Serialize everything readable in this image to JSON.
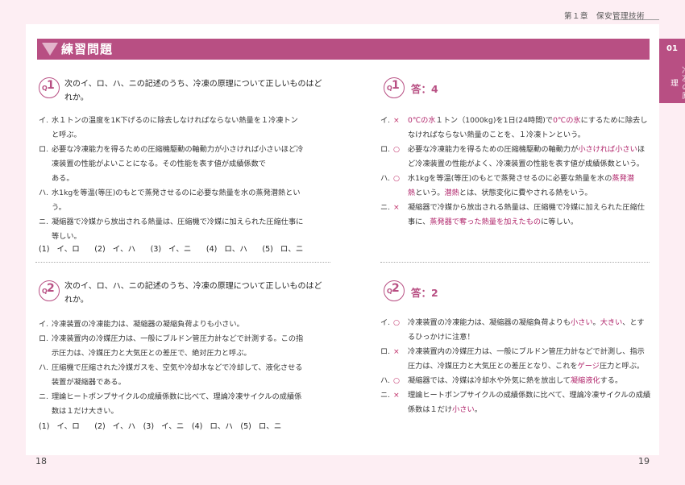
{
  "header": {
    "chapter": "第１章　保安管理技術"
  },
  "title": "練習問題",
  "side": {
    "number": "01",
    "label": "冷凍の原理"
  },
  "questions": [
    {
      "q": "Q",
      "n": "1",
      "text_line1": "次のイ、ロ、ハ、ニの記述のうち、冷凍の原理について正しいものはど",
      "text_line2": "れか。",
      "items": [
        {
          "label": "イ.",
          "lines": [
            "水１トンの温度を1K下げるのに除去しなければならない熱量を１冷凍トン",
            "と呼ぶ。"
          ]
        },
        {
          "label": "ロ.",
          "lines": [
            "必要な冷凍能力を得るための圧縮機駆動の軸動力が小さければ小さいほど冷",
            "凍装置の性能がよいことになる。その性能を表す値が成績係数で",
            "ある。"
          ]
        },
        {
          "label": "ハ.",
          "lines": [
            "水1kgを等温(等圧)のもとで蒸発させるのに必要な熱量を水の蒸発潜熱とい",
            "う。"
          ]
        },
        {
          "label": "ニ.",
          "lines": [
            "凝縮器で冷媒から放出される熱量は、圧縮機で冷媒に加えられた圧縮仕事に",
            "等しい。"
          ]
        }
      ],
      "choices": "(1) イ、ロ　 (2) イ、ハ　 (3) イ、ニ　 (4) ロ、ハ　 (5) ロ、ニ"
    },
    {
      "q": "Q",
      "n": "2",
      "text_line1": "次のイ、ロ、ハ、ニの記述のうち、冷凍の原理について正しいものはど",
      "text_line2": "れか。",
      "items": [
        {
          "label": "イ.",
          "lines": [
            "冷凍装置の冷凍能力は、凝縮器の凝縮負荷よりも小さい。"
          ]
        },
        {
          "label": "ロ.",
          "lines": [
            "冷凍装置内の冷媒圧力は、一般にブルドン管圧力計などで計測する。この指",
            "示圧力は、冷媒圧力と大気圧との差圧で、絶対圧力と呼ぶ。"
          ]
        },
        {
          "label": "ハ.",
          "lines": [
            "圧縮機で圧縮された冷媒ガスを、空気や冷却水などで冷却して、液化させる",
            "装置が凝縮器である。"
          ]
        },
        {
          "label": "ニ.",
          "lines": [
            "理論ヒートポンプサイクルの成績係数に比べて、理論冷凍サイクルの成績係",
            "数は１だけ大きい。"
          ]
        }
      ],
      "choices": "(1) イ、ロ　 (2) イ、ハ　(3) イ、ニ　(4) ロ、ハ　(5) ロ、ニ"
    }
  ],
  "answers": [
    {
      "q": "Q",
      "n": "1",
      "answer": "答：4",
      "items": [
        {
          "label": "イ.",
          "mark": "×",
          "lines": [
            [
              {
                "t": "0℃の水",
                "h": true
              },
              {
                "t": "１トン（1000kg)を1日(24時間)で",
                "h": false
              },
              {
                "t": "0℃の氷",
                "h": true
              },
              {
                "t": "にするために除去し",
                "h": false
              }
            ],
            [
              {
                "t": "なければならない熱量のことを、１冷凍トンという。",
                "h": false
              }
            ]
          ]
        },
        {
          "label": "ロ.",
          "mark": "○",
          "lines": [
            [
              {
                "t": "必要な冷凍能力を得るための圧縮機駆動の軸動力が",
                "h": false
              },
              {
                "t": "小さければ小さい",
                "h": true
              },
              {
                "t": "ほ",
                "h": false
              }
            ],
            [
              {
                "t": "ど冷凍装置の性能がよく、冷凍装置の性能を表す値が成績係数という。",
                "h": false
              }
            ]
          ]
        },
        {
          "label": "ハ.",
          "mark": "○",
          "lines": [
            [
              {
                "t": "水1kgを等温(等圧)のもとで蒸発させるのに必要な熱量を水の",
                "h": false
              },
              {
                "t": "蒸発潜",
                "h": true
              }
            ],
            [
              {
                "t": "熱",
                "h": true
              },
              {
                "t": "という。",
                "h": false
              },
              {
                "t": "潜熱",
                "h": true
              },
              {
                "t": "とは、状態変化に費やされる熱をいう。",
                "h": false
              }
            ]
          ]
        },
        {
          "label": "ニ.",
          "mark": "×",
          "lines": [
            [
              {
                "t": "凝縮器で冷媒から放出される熱量は、圧縮機で冷媒に加えられた圧縮仕",
                "h": false
              }
            ],
            [
              {
                "t": "事に、",
                "h": false
              },
              {
                "t": "蒸発器で奪った熱量を加えたもの",
                "h": true
              },
              {
                "t": "に等しい。",
                "h": false
              }
            ]
          ]
        }
      ]
    },
    {
      "q": "Q",
      "n": "2",
      "answer": "答：2",
      "items": [
        {
          "label": "イ.",
          "mark": "○",
          "lines": [
            [
              {
                "t": "冷凍装置の冷凍能力は、凝縮器の凝縮負荷よりも",
                "h": false
              },
              {
                "t": "小さい",
                "h": true
              },
              {
                "t": "。",
                "h": false
              },
              {
                "t": "大きい",
                "h": true
              },
              {
                "t": "、とす",
                "h": false
              }
            ],
            [
              {
                "t": "るひっかけに注意！",
                "h": false
              }
            ]
          ]
        },
        {
          "label": "ロ.",
          "mark": "×",
          "lines": [
            [
              {
                "t": "冷凍装置内の冷媒圧力は、一般にブルドン管圧力計などで計測し、指示",
                "h": false
              }
            ],
            [
              {
                "t": "圧力は、冷媒圧力と大気圧との差圧となり、これを",
                "h": false
              },
              {
                "t": "ゲージ",
                "h": true
              },
              {
                "t": "圧力と呼ぶ。",
                "h": false
              }
            ]
          ]
        },
        {
          "label": "ハ.",
          "mark": "○",
          "lines": [
            [
              {
                "t": "凝縮器では、冷媒は冷却水や外気に熱を放出して",
                "h": false
              },
              {
                "t": "凝縮液化",
                "h": true
              },
              {
                "t": "する。",
                "h": false
              }
            ]
          ]
        },
        {
          "label": "ニ.",
          "mark": "×",
          "lines": [
            [
              {
                "t": "理論ヒートポンプサイクルの成績係数に比べて、理論冷凍サイクルの成績",
                "h": false
              }
            ],
            [
              {
                "t": "係数は１だけ",
                "h": false
              },
              {
                "t": "小さい",
                "h": true
              },
              {
                "t": "。",
                "h": false
              }
            ]
          ]
        }
      ]
    }
  ],
  "pages": {
    "left": "18",
    "right": "19"
  }
}
